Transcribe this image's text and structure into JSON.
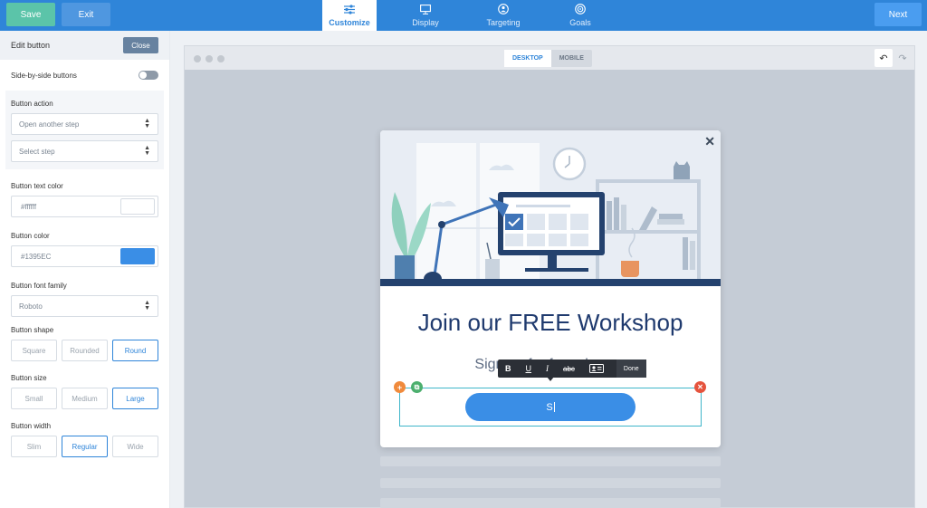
{
  "topbar": {
    "save": "Save",
    "exit": "Exit",
    "next": "Next",
    "tabs": [
      {
        "label": "Customize",
        "icon": "sliders-icon"
      },
      {
        "label": "Display",
        "icon": "monitor-icon"
      },
      {
        "label": "Targeting",
        "icon": "person-icon"
      },
      {
        "label": "Goals",
        "icon": "target-icon"
      }
    ]
  },
  "sidebar": {
    "title": "Edit button",
    "close": "Close",
    "side_by_side": "Side-by-side buttons",
    "action": {
      "label": "Button action",
      "step_type": "Open another step",
      "step": "Select step"
    },
    "text_color": {
      "label": "Button text color",
      "value": "#ffffff"
    },
    "color": {
      "label": "Button color",
      "value": "#1395EC"
    },
    "font": {
      "label": "Button font family",
      "value": "Roboto"
    },
    "shape": {
      "label": "Button shape",
      "options": [
        "Square",
        "Rounded",
        "Round"
      ],
      "selected": "Round"
    },
    "size": {
      "label": "Button size",
      "options": [
        "Small",
        "Medium",
        "Large"
      ],
      "selected": "Large"
    },
    "width": {
      "label": "Button width",
      "options": [
        "Slim",
        "Regular",
        "Wide"
      ],
      "selected": "Regular"
    }
  },
  "canvas": {
    "desktop": "DESKTOP",
    "mobile": "MOBILE"
  },
  "popup": {
    "headline": "Join our FREE Workshop",
    "subhead": "Sign up for free classes",
    "button_text": "S",
    "toolbar": {
      "bold": "B",
      "underline": "U",
      "italic": "I",
      "strike": "abc",
      "done": "Done"
    }
  },
  "colors": {
    "brand": "#2f85d9",
    "save": "#5bc4a9",
    "button": "#3a8ee6",
    "selection": "#3fb6c9"
  }
}
